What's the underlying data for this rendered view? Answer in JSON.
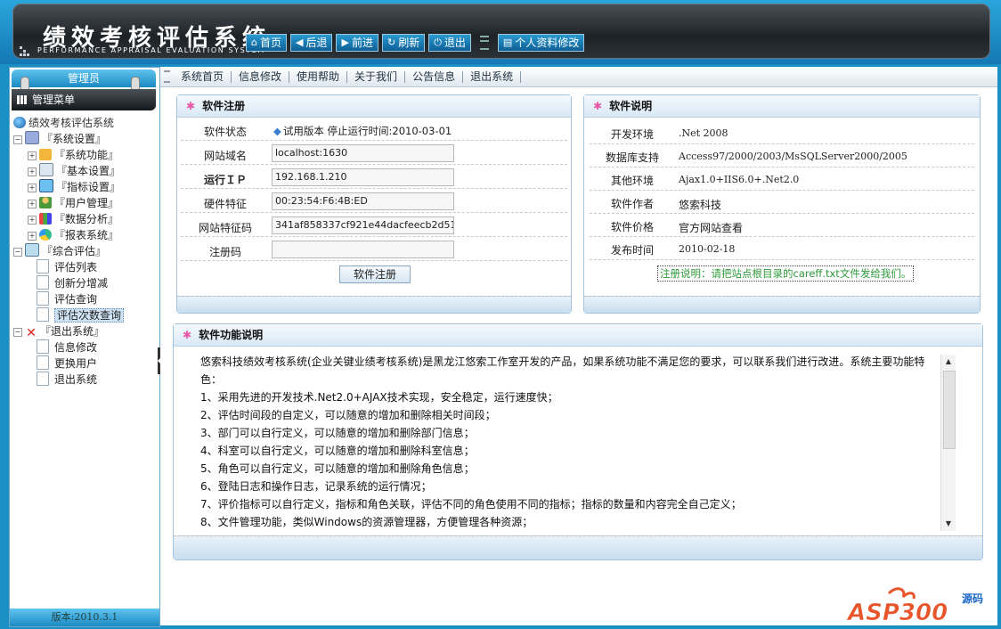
{
  "header": {
    "title": "绩效考核评估系统",
    "subtitle": "PERFORMANCE APPRAISAL EVALUATION SYSTEM",
    "buttons": [
      {
        "icon": "home-icon",
        "label": "首页"
      },
      {
        "icon": "back-arrow-icon",
        "label": "后退"
      },
      {
        "icon": "forward-arrow-icon",
        "label": "前进"
      },
      {
        "icon": "refresh-icon",
        "label": "刷新"
      },
      {
        "icon": "power-icon",
        "label": "退出"
      }
    ],
    "profile_button": "个人资料修改"
  },
  "sidebar": {
    "tab_label": "管理员",
    "menu_title": "管理菜单",
    "root": "绩效考核评估系统",
    "groups": [
      {
        "label": "『系统设置』",
        "items": [
          "『系统功能』",
          "『基本设置』",
          "『指标设置』",
          "『用户管理』",
          "『数据分析』",
          "『报表系统』"
        ]
      },
      {
        "label": "『综合评估』",
        "items": [
          "评估列表",
          "创新分增减",
          "评估查询",
          "评估次数查询"
        ]
      },
      {
        "label": "『退出系统』",
        "items": [
          "信息修改",
          "更换用户",
          "退出系统"
        ]
      }
    ],
    "selected_item": "评估次数查询",
    "version": "版本:2010.3.1"
  },
  "topnav": [
    "系统首页",
    "信息修改",
    "使用帮助",
    "关于我们",
    "公告信息",
    "退出系统"
  ],
  "register_panel": {
    "title": "软件注册",
    "status_label": "软件状态",
    "status_value": "试用版本 停止运行时间:2010-03-01",
    "fields": [
      {
        "label": "网站域名",
        "value": "localhost:1630"
      },
      {
        "label": "运行ＩＰ",
        "value": "192.168.1.210"
      },
      {
        "label": "硬件特征",
        "value": "00:23:54:F6:4B:ED"
      },
      {
        "label": "网站特征码",
        "value": "341af858337cf921e44dacfeecb2d51"
      },
      {
        "label": "注册码",
        "value": ""
      }
    ],
    "button": "软件注册"
  },
  "info_panel": {
    "title": "软件说明",
    "rows": [
      {
        "label": "开发环境",
        "value": ".Net 2008"
      },
      {
        "label": "数据库支持",
        "value": "Access97/2000/2003/MsSQLServer2000/2005"
      },
      {
        "label": "其他环境",
        "value": "Ajax1.0+IIS6.0+.Net2.0"
      },
      {
        "label": "软件作者",
        "value": "悠索科技"
      },
      {
        "label": "软件价格",
        "value": "官方网站查看"
      },
      {
        "label": "发布时间",
        "value": "2010-02-18"
      }
    ],
    "note": "注册说明：请把站点根目录的careff.txt文件发给我们。"
  },
  "function_panel": {
    "title": "软件功能说明",
    "lines": [
      "悠索科技绩效考核系统(企业关键业绩考核系统)是黑龙江悠索工作室开发的产品，如果系统功能不满足您的要求，可以联系我们进行改进。系统主要功能特",
      "色：",
      "1、采用先进的开发技术.Net2.0+AJAX技术实现，安全稳定，运行速度快；",
      "2、评估时间段的自定义，可以随意的增加和删除相关时间段；",
      "3、部门可以自行定义，可以随意的增加和删除部门信息；",
      "4、科室可以自行定义，可以随意的增加和删除科室信息；",
      "5、角色可以自行定义，可以随意的增加和删除角色信息；",
      "6、登陆日志和操作日志，记录系统的运行情况；",
      "7、评价指标可以自行定义，指标和角色关联，评估不同的角色使用不同的指标；指标的数量和内容完全自己定义；",
      "8、文件管理功能，类似Windows的资源管理器，方便管理各种资源；"
    ]
  },
  "watermark": {
    "text": "ASP300",
    "suffix": "源码"
  }
}
